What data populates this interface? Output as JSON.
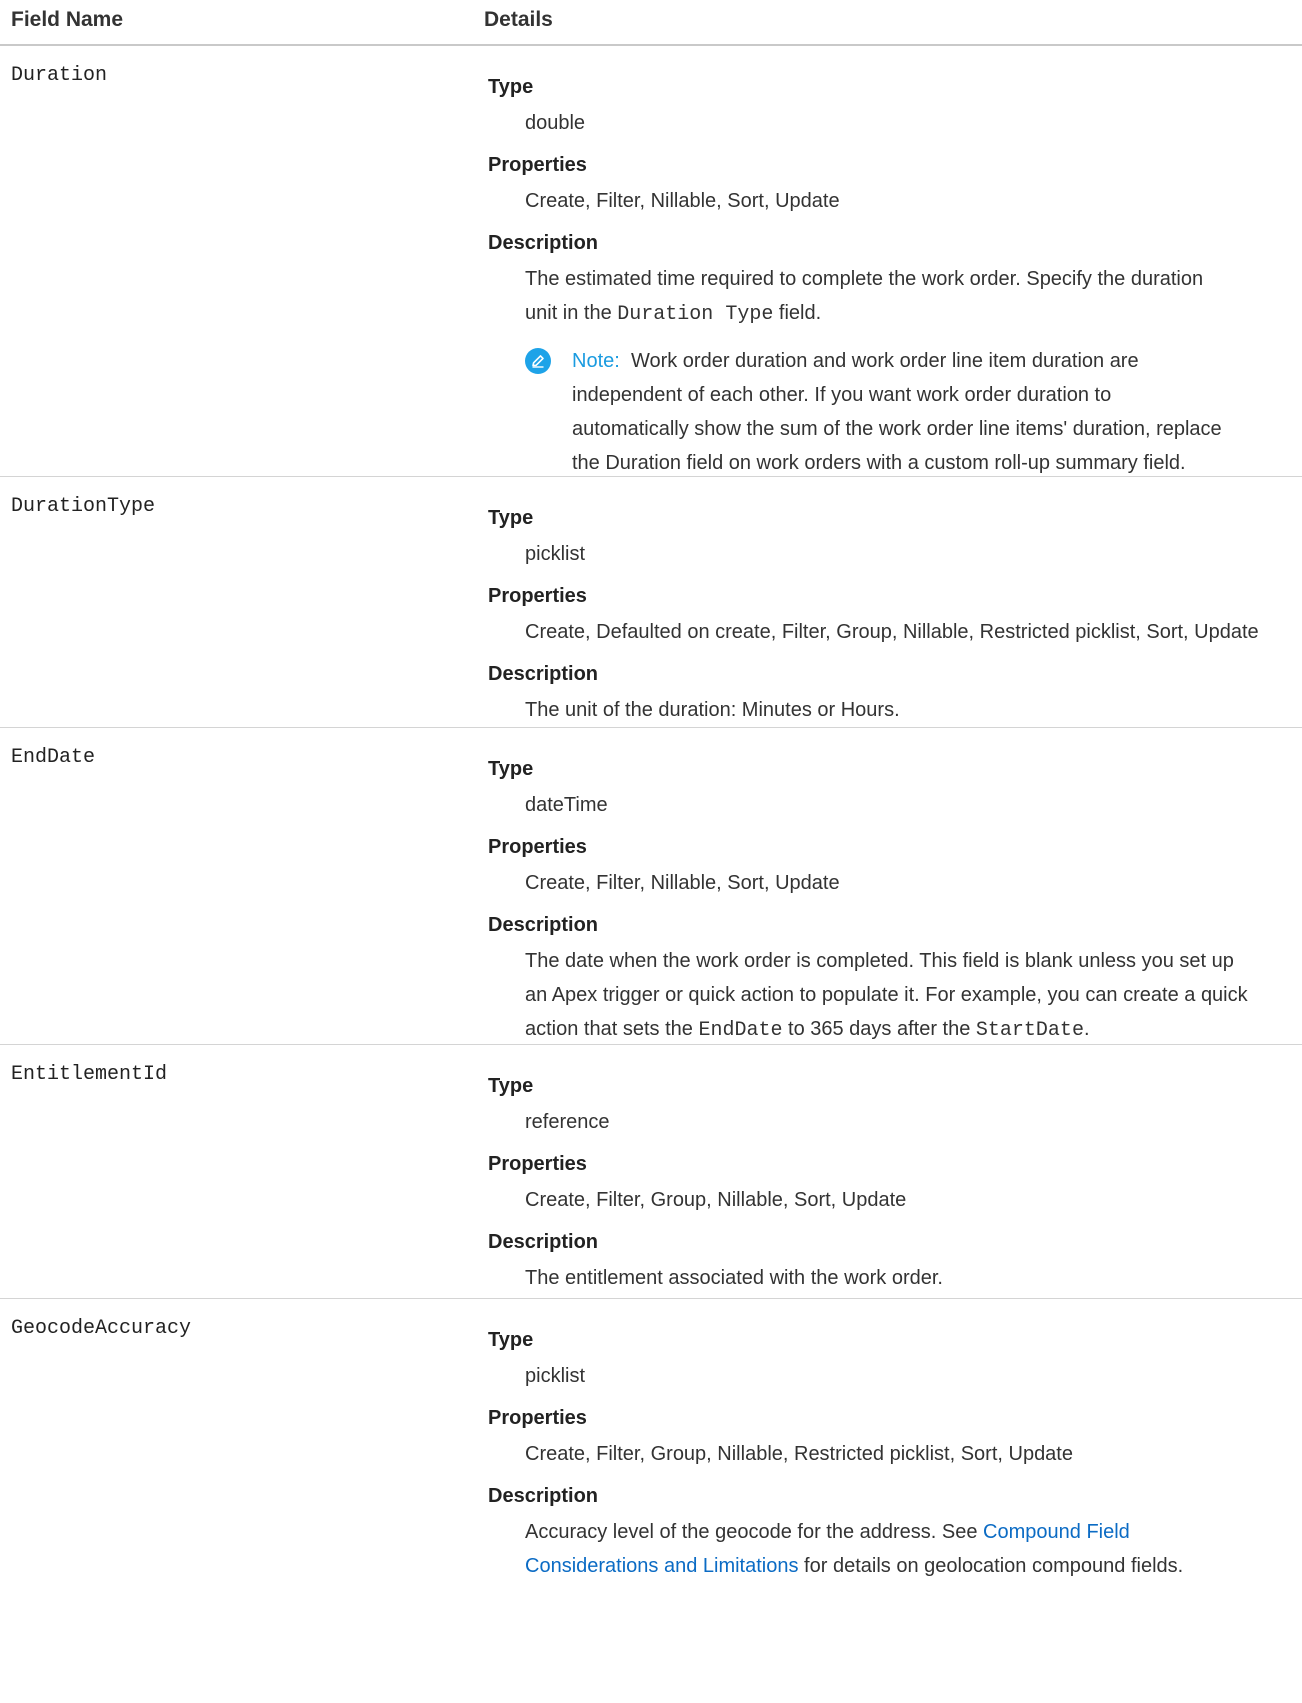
{
  "header": {
    "col_field": "Field Name",
    "col_details": "Details"
  },
  "labels": {
    "type": "Type",
    "properties": "Properties",
    "description": "Description"
  },
  "fields": [
    {
      "name": "Duration",
      "type": "double",
      "properties": "Create, Filter, Nillable, Sort, Update",
      "desc_a": "The estimated time required to complete the work order. Specify the duration",
      "desc_b": "unit in the ",
      "desc_code": "Duration Type",
      "desc_c": " field.",
      "note_label": "Note:",
      "note_line1": "Work order duration and work order line item duration are",
      "note_line2": "independent of each other. If you want work order duration to",
      "note_line3": "automatically show the sum of the work order line items' duration, replace",
      "note_line4": "the Duration field on work orders with a custom roll-up summary field.",
      "note_icon": "edit-note-icon"
    },
    {
      "name": "DurationType",
      "type": "picklist",
      "properties": "Create, Defaulted on create, Filter, Group, Nillable, Restricted picklist, Sort, Update",
      "description": "The unit of the duration: Minutes or Hours."
    },
    {
      "name": "EndDate",
      "type": "dateTime",
      "properties": "Create, Filter, Nillable, Sort, Update",
      "desc_a": "The date when the work order is completed. This field is blank unless you set up",
      "desc_b": "an Apex trigger or quick action to populate it. For example, you can create a quick",
      "desc_c1": "action that sets the ",
      "desc_code1": "EndDate",
      "desc_c2": " to 365 days after the ",
      "desc_code2": "StartDate",
      "desc_c3": "."
    },
    {
      "name": "EntitlementId",
      "type": "reference",
      "properties": "Create, Filter, Group, Nillable, Sort, Update",
      "description": "The entitlement associated with the work order."
    },
    {
      "name": "GeocodeAccuracy",
      "type": "picklist",
      "properties": "Create, Filter, Group, Nillable, Restricted picklist, Sort, Update",
      "desc_a": "Accuracy level of the geocode for the address. See ",
      "link_a": "Compound Field",
      "link_b": "Considerations and Limitations",
      "desc_b": " for details on geolocation compound fields."
    }
  ],
  "colors": {
    "link": "#0b6bc4",
    "note_icon_bg": "#1ea3e8",
    "divider": "#d4d4d4"
  }
}
